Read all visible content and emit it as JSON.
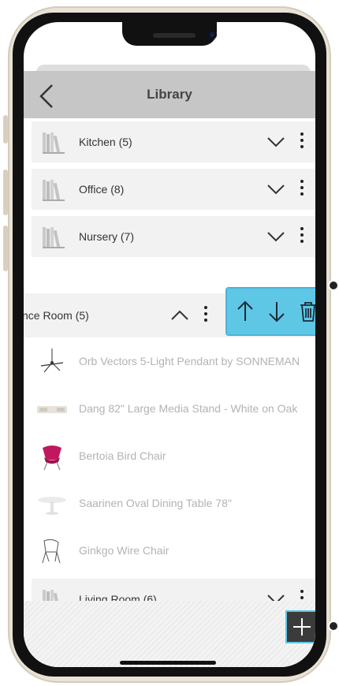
{
  "header": {
    "title": "Library"
  },
  "categories": [
    {
      "label": "Kitchen (5)"
    },
    {
      "label": "Office (8)"
    },
    {
      "label": "Nursery (7)"
    }
  ],
  "expanded": {
    "label": "nce Room (5)",
    "items": [
      {
        "label": "Orb Vectors 5-Light Pendant by SONNEMAN",
        "icon": "pendant-light-icon"
      },
      {
        "label": "Dang 82\" Large Media Stand - White on Oak",
        "icon": "media-stand-icon"
      },
      {
        "label": "Bertoia Bird Chair",
        "icon": "bird-chair-icon"
      },
      {
        "label": "Saarinen Oval Dining Table 78\"",
        "icon": "dining-table-icon"
      },
      {
        "label": "Ginkgo Wire Chair",
        "icon": "wire-chair-icon"
      }
    ]
  },
  "last_category": {
    "label": "Living Room (6)"
  },
  "actions": [
    "move-up-icon",
    "move-down-icon",
    "trash-icon"
  ],
  "colors": {
    "accent": "#5ec7e6",
    "navbar": "#c6c6c6",
    "row": "#f2f2f2",
    "muted_text": "#b3b3b3"
  }
}
